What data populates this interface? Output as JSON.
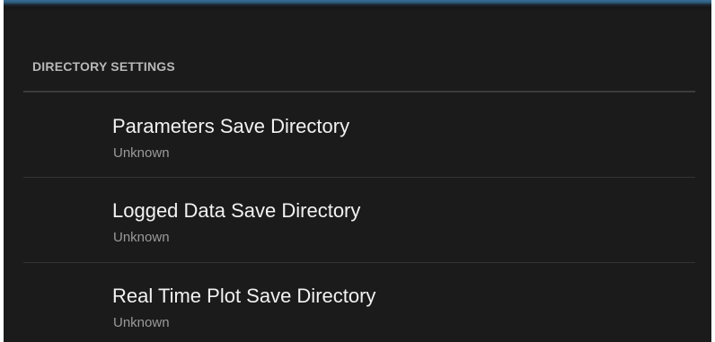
{
  "section": {
    "title": "DIRECTORY SETTINGS"
  },
  "preferences": [
    {
      "title": "Parameters Save Directory",
      "summary": "Unknown"
    },
    {
      "title": "Logged Data Save Directory",
      "summary": "Unknown"
    },
    {
      "title": "Real Time Plot Save Directory",
      "summary": "Unknown"
    }
  ],
  "colors": {
    "background": "#1b1b1b",
    "title_text": "#f2f2f2",
    "summary_text": "#9a9a9a",
    "header_text": "#b8b8b8",
    "top_accent": "#3a6f9a"
  }
}
